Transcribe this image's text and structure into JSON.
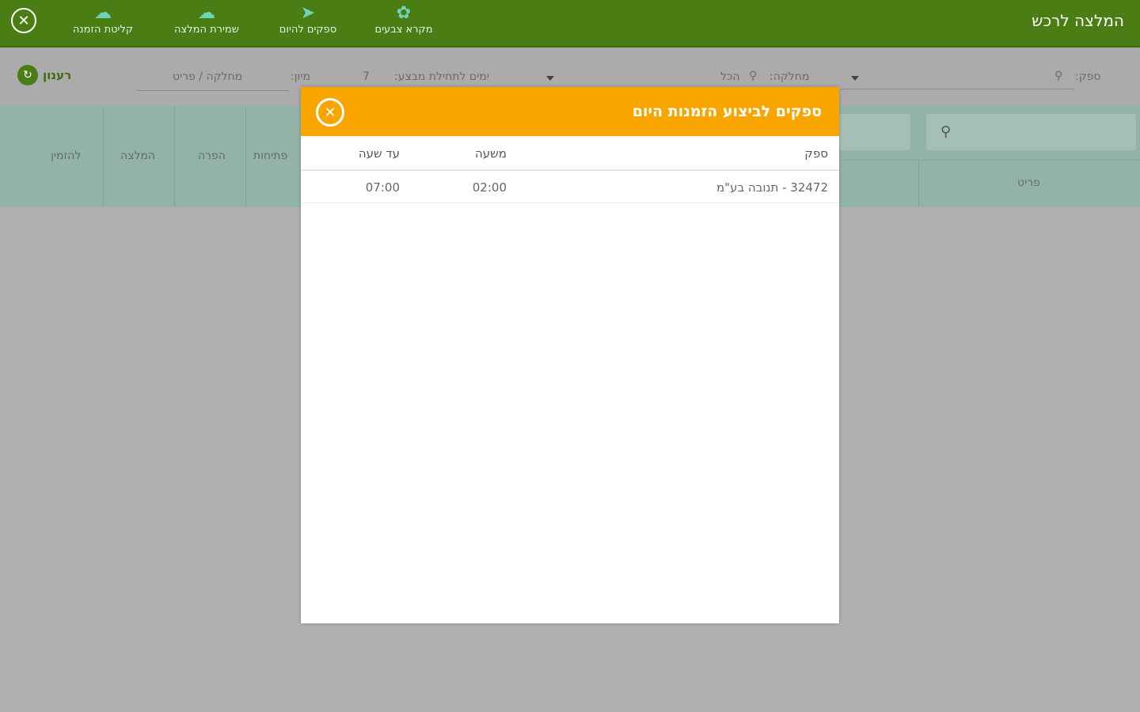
{
  "header": {
    "title": "המלצה לרכש",
    "toolbar": [
      {
        "label": "קליטת הזמנה",
        "icon": "cloud-check-icon"
      },
      {
        "label": "שמירת המלצה",
        "icon": "cloud-upload-icon"
      },
      {
        "label": "ספקים להיום",
        "icon": "paper-plane-icon"
      },
      {
        "label": "מקרא צבעים",
        "icon": "palette-icon"
      }
    ]
  },
  "filters": {
    "supplier_label": "ספק:",
    "department_label": "מחלקה:",
    "department_value": "הכל",
    "days_label": "ימים לתחילת מבצע:",
    "days_value": "7",
    "sort_label": "מיון:",
    "sort_value": "מחלקה / פריט",
    "refresh_label": "רענון"
  },
  "table": {
    "columns": [
      "להזמין",
      "המלצה",
      "הפרה",
      "פתיחות"
    ],
    "item_column": "פריט"
  },
  "modal": {
    "title": "ספקים לביצוע הזמנות היום",
    "columns": {
      "supplier": "ספק",
      "from": "משעה",
      "to": "עד שעה"
    },
    "rows": [
      {
        "supplier": "32472 - תנובה בע\"מ",
        "from": "02:00",
        "to": "07:00"
      }
    ]
  },
  "colors": {
    "topbar": "#4a7d14",
    "modal_header": "#f8a500",
    "table_header": "#93b3a6",
    "overlay": "#b0b0b0"
  }
}
